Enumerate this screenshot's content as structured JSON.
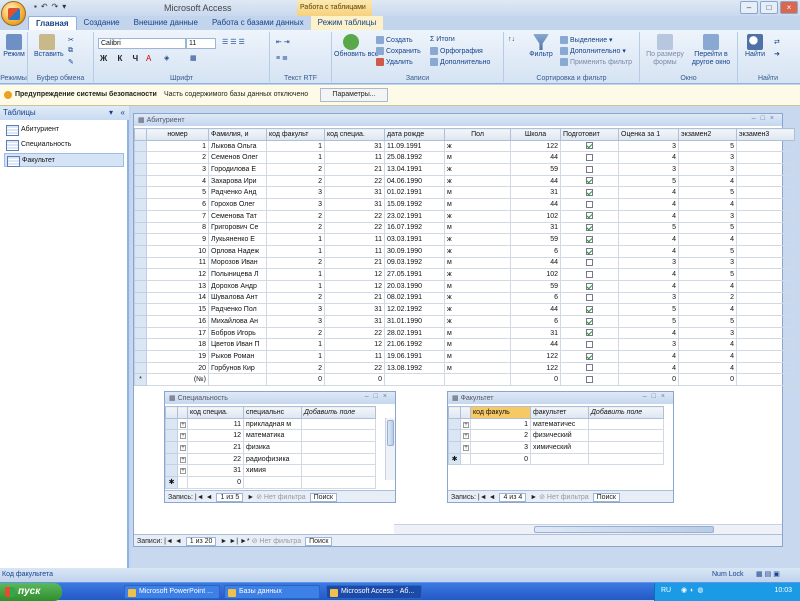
{
  "titlebar": {
    "app_title": "Microsoft Access",
    "context_tab_group": "Работа с таблицами"
  },
  "tabs": [
    "Главная",
    "Создание",
    "Внешние данные",
    "Работа с базами данных",
    "Режим таблицы"
  ],
  "ribbon": {
    "groups": {
      "views": "Режимы",
      "clipboard": "Буфер обмена",
      "font": "Шрифт",
      "rtf": "Текст RTF",
      "records": "Записи",
      "sort_filter": "Сортировка и фильтр",
      "window": "Окно",
      "find": "Найти"
    },
    "buttons": {
      "view": "Режим",
      "paste": "Вставить",
      "refresh": "Обновить все",
      "new": "Создать",
      "save": "Сохранить",
      "delete": "Удалить",
      "totals": "Итоги",
      "spelling": "Орфография",
      "more": "Дополнительно",
      "filter": "Фильтр",
      "selection": "Выделение",
      "advanced": "Дополнительно",
      "toggle_filter": "Применить фильтр",
      "fit_form": "По размеру формы",
      "switch_window": "Перейти в другое окно",
      "find": "Найти"
    },
    "font_name": "Calibri",
    "font_size": "11"
  },
  "security": {
    "title": "Предупреждение системы безопасности",
    "message": "Часть содержимого базы данных отключено",
    "button": "Параметры..."
  },
  "nav": {
    "header": "Таблицы",
    "items": [
      "Абитуриент",
      "Специальность",
      "Факультет"
    ]
  },
  "main_table": {
    "title": "Абитуриент",
    "columns": [
      "номер",
      "Фамилия, и",
      "код факульт",
      "код специа.",
      "дата рожде",
      "Пол",
      "Школа",
      "Подготовит",
      "Оценка за 1",
      "экзамен2",
      "экзамен3"
    ],
    "rows": [
      [
        "1",
        "Лыкова Ольга",
        "1",
        "31",
        "11.09.1991",
        "ж",
        "122",
        true,
        "3",
        "5"
      ],
      [
        "2",
        "Семенов Олег",
        "1",
        "11",
        "25.08.1992",
        "м",
        "44",
        false,
        "4",
        "3"
      ],
      [
        "3",
        "Городилова Е",
        "2",
        "21",
        "13.04.1991",
        "ж",
        "59",
        false,
        "3",
        "3"
      ],
      [
        "4",
        "Захарова Ири",
        "2",
        "22",
        "04.06.1990",
        "ж",
        "44",
        true,
        "5",
        "4"
      ],
      [
        "5",
        "Радченко Анд",
        "3",
        "31",
        "01.02.1991",
        "м",
        "31",
        true,
        "4",
        "5"
      ],
      [
        "6",
        "Горохов Олег",
        "3",
        "31",
        "15.09.1992",
        "м",
        "44",
        false,
        "4",
        "4"
      ],
      [
        "7",
        "Семенова Тат",
        "2",
        "22",
        "23.02.1991",
        "ж",
        "102",
        true,
        "4",
        "3"
      ],
      [
        "8",
        "Григорович Се",
        "2",
        "22",
        "16.07.1992",
        "м",
        "31",
        true,
        "5",
        "5"
      ],
      [
        "9",
        "Лукьяненко Е",
        "1",
        "11",
        "03.03.1991",
        "ж",
        "59",
        true,
        "4",
        "4"
      ],
      [
        "10",
        "Орлова Надеж",
        "1",
        "11",
        "30.09.1990",
        "ж",
        "6",
        true,
        "4",
        "5"
      ],
      [
        "11",
        "Морозов Иван",
        "2",
        "21",
        "09.03.1992",
        "м",
        "44",
        false,
        "3",
        "3"
      ],
      [
        "12",
        "Полыницева Л",
        "1",
        "12",
        "27.05.1991",
        "ж",
        "102",
        false,
        "4",
        "5"
      ],
      [
        "13",
        "Дорохов Андр",
        "1",
        "12",
        "20.03.1990",
        "м",
        "59",
        true,
        "4",
        "4"
      ],
      [
        "14",
        "Шувалова Ант",
        "2",
        "21",
        "08.02.1991",
        "ж",
        "6",
        false,
        "3",
        "2"
      ],
      [
        "15",
        "Радченко Пол",
        "3",
        "31",
        "12.02.1992",
        "ж",
        "44",
        true,
        "5",
        "4"
      ],
      [
        "16",
        "Михайлова Ан",
        "3",
        "31",
        "31.01.1990",
        "ж",
        "6",
        true,
        "5",
        "5"
      ],
      [
        "17",
        "Бобров Игорь",
        "2",
        "22",
        "28.02.1991",
        "м",
        "31",
        true,
        "4",
        "3"
      ],
      [
        "18",
        "Цветов Иван П",
        "1",
        "12",
        "21.06.1992",
        "м",
        "44",
        false,
        "3",
        "4"
      ],
      [
        "19",
        "Рыков Роман",
        "1",
        "11",
        "19.06.1991",
        "м",
        "122",
        true,
        "4",
        "4"
      ],
      [
        "20",
        "Горбунов Кир",
        "2",
        "22",
        "13.08.1992",
        "м",
        "122",
        false,
        "4",
        "4"
      ]
    ],
    "new_row": {
      "marker": "*",
      "id": "(№)",
      "fac": "0",
      "spec": "0",
      "school": "0",
      "score": "0",
      "exam2": "0"
    },
    "nav": {
      "label": "Записи:",
      "position": "1 из 20",
      "filter": "Нет фильтра",
      "search": "Поиск"
    }
  },
  "spec_table": {
    "title": "Специальность",
    "columns": [
      "код специа.",
      "специальнс",
      "Добавить поле"
    ],
    "rows": [
      [
        "11",
        "прикладная м"
      ],
      [
        "12",
        "математика"
      ],
      [
        "21",
        "физика"
      ],
      [
        "22",
        "радиофизика"
      ],
      [
        "31",
        "химия"
      ]
    ],
    "new_row": "0",
    "nav": {
      "label": "Запись:",
      "position": "1 из 5",
      "filter": "Нет фильтра",
      "search": "Поиск"
    }
  },
  "fac_table": {
    "title": "Факультет",
    "columns": [
      "код факуль",
      "факультет",
      "Добавить поле"
    ],
    "rows": [
      [
        "1",
        "математичес"
      ],
      [
        "2",
        "физический"
      ],
      [
        "3",
        "химический"
      ]
    ],
    "new_row": "0",
    "nav": {
      "label": "Запись:",
      "position": "4 из 4",
      "filter": "Нет фильтра",
      "search": "Поиск"
    }
  },
  "statusbar": {
    "left": "Код факультета",
    "num_lock": "Num Lock"
  },
  "taskbar": {
    "start": "пуск",
    "tasks": [
      "Microsoft PowerPoint ...",
      "Базы данных",
      "Microsoft Access - Аб..."
    ],
    "lang": "RU",
    "clock": "10:03"
  }
}
